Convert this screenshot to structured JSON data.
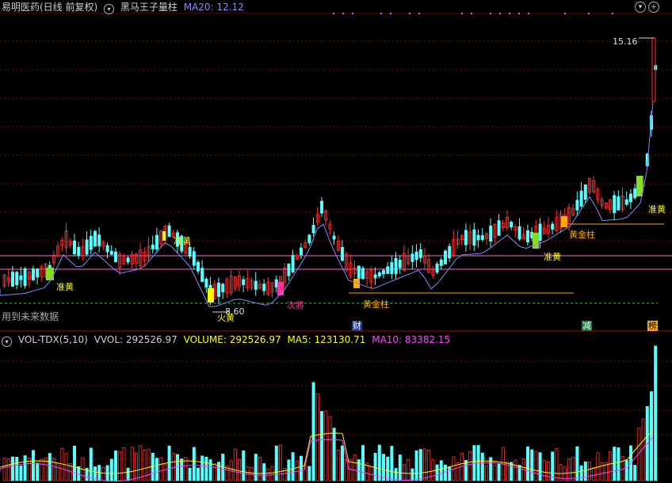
{
  "header": {
    "stock": "易明医药(日线 前复权)",
    "indicator": "黑马王子量柱",
    "ma20_label": "MA20:",
    "ma20_value": "12.12"
  },
  "vol_header": {
    "name": "VOL-TDX(5,10)",
    "vvol": "VVOL: 292526.97",
    "volume": "VOLUME: 292526.97",
    "ma5": "MA5: 123130.71",
    "ma10": "MA10: 83382.15"
  },
  "labels": {
    "future_data": "用到未来数据",
    "high_price": "15.16",
    "low_price": "8.60",
    "marker_cai": "财",
    "marker_jian": "减",
    "marker_bang": "榜"
  },
  "signals": [
    {
      "text": "准黄",
      "color": "#ffff00"
    },
    {
      "text": "准黄",
      "color": "#ffff00"
    },
    {
      "text": "火黄",
      "color": "#ffff00"
    },
    {
      "text": "次將",
      "color": "#ff3399"
    },
    {
      "text": "黄金柱",
      "color": "#ffaa00"
    },
    {
      "text": "准黄",
      "color": "#ffff00"
    },
    {
      "text": "黄金柱",
      "color": "#ffaa00"
    },
    {
      "text": "准黄",
      "color": "#ffff00"
    }
  ],
  "colors": {
    "up": "#ff3232",
    "down": "#54ffff",
    "ma20": "#8888ff",
    "ma5": "#ffff00",
    "ma10": "#ff44ff",
    "grid": "#880000"
  },
  "icons": [
    "settings-toggle-icon",
    "indicator-toggle-icon",
    "collapse-icon",
    "zoom-out-icon",
    "zoom-in-icon",
    "vol-toggle-icon"
  ]
}
